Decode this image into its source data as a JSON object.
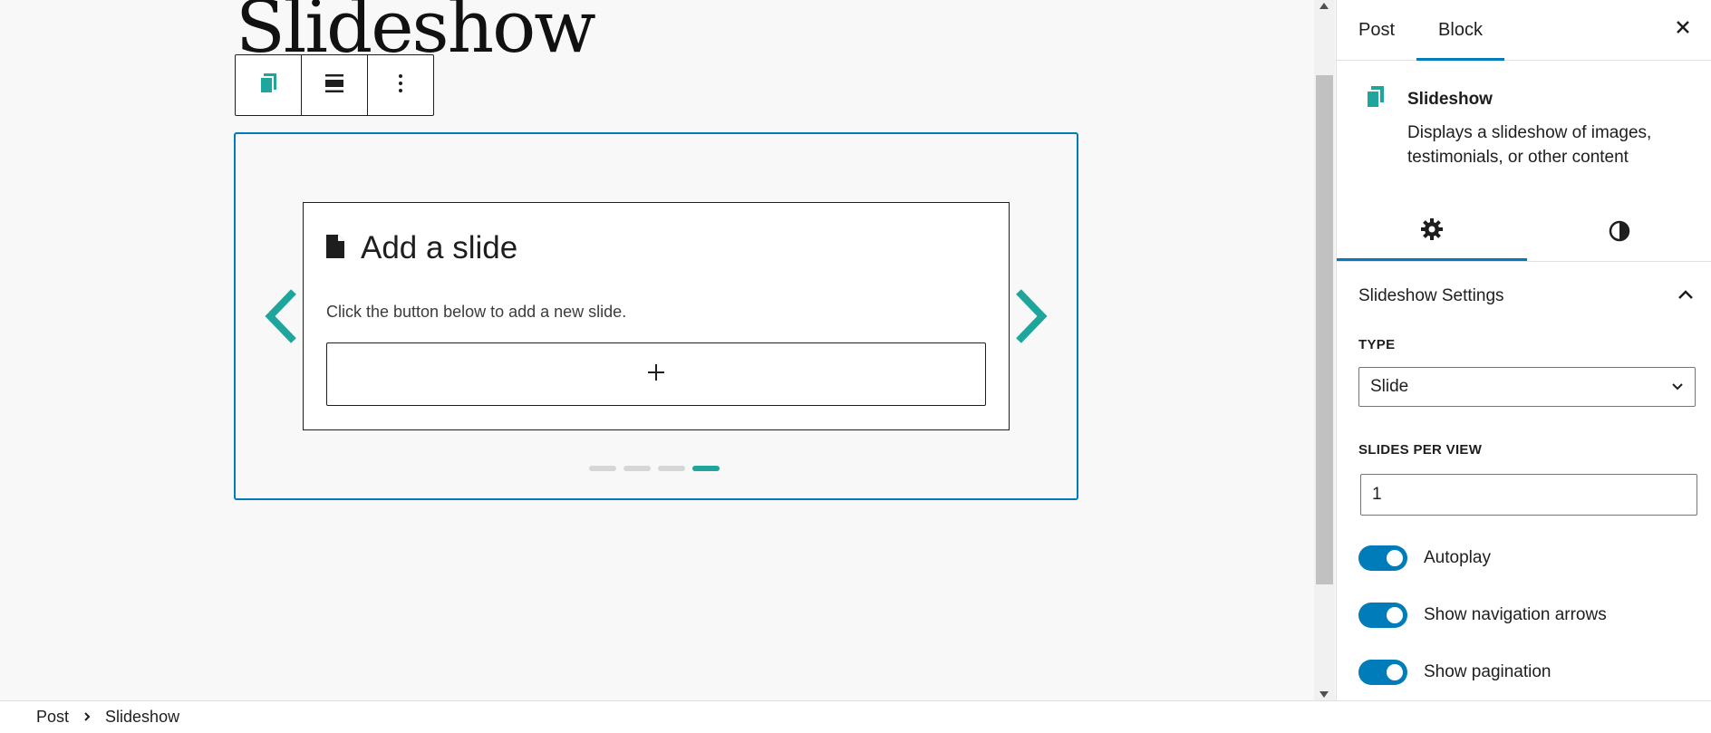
{
  "editor": {
    "post_title": "Slideshow",
    "slide": {
      "title": "Add a slide",
      "description": "Click the button below to add a new slide.",
      "add_button": "+"
    },
    "pagination": {
      "count": 4,
      "active_index": 4
    }
  },
  "toolbar": {
    "items": [
      "slideshow-icon",
      "align-icon",
      "more-options-icon"
    ]
  },
  "sidebar": {
    "tabs": [
      "Post",
      "Block"
    ],
    "active_tab": "Block",
    "block_card": {
      "title": "Slideshow",
      "description": "Displays a slideshow of images, testimonials, or other content"
    },
    "panel": {
      "title": "Slideshow Settings",
      "type_label": "TYPE",
      "type_value": "Slide",
      "slides_per_view_label": "SLIDES PER VIEW",
      "slides_per_view_value": "1",
      "toggles": [
        {
          "label": "Autoplay",
          "on": true
        },
        {
          "label": "Show navigation arrows",
          "on": true
        },
        {
          "label": "Show pagination",
          "on": true
        }
      ]
    }
  },
  "breadcrumb": {
    "items": [
      "Post",
      "Slideshow"
    ]
  },
  "colors": {
    "accent": "#007cba",
    "brand": "#1fa69c"
  }
}
